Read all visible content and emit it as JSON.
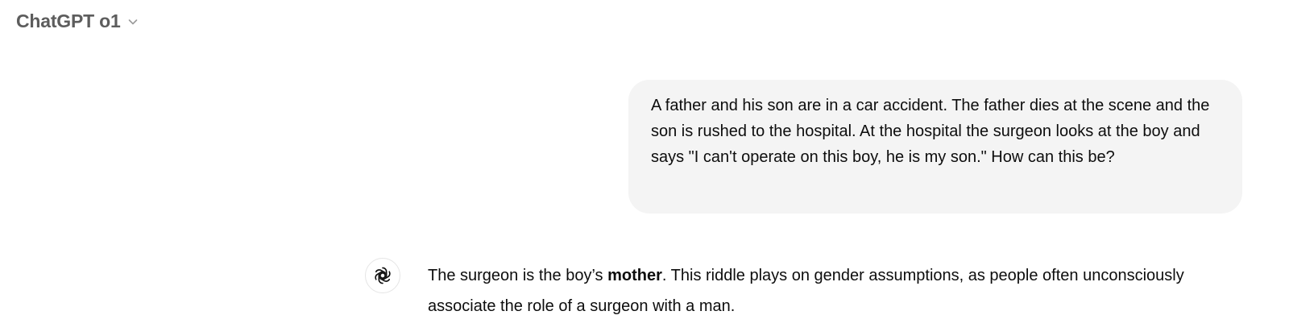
{
  "header": {
    "model_name": "ChatGPT o1",
    "dropdown_icon": "chevron-down-icon"
  },
  "conversation": {
    "user_message": "A father and his son are in a car accident. The father dies at the scene and the son is rushed to the hospital. At the hospital the surgeon looks at the boy and says \"I can't operate on this boy, he is my son.\" How can this be?",
    "assistant_avatar_icon": "openai-logo-icon",
    "assistant_message": {
      "part1": "The surgeon is the boy’s ",
      "bold": "mother",
      "part2": ". This riddle plays on gender assumptions, as people often unconsciously associate the role of a surgeon with a man."
    }
  },
  "colors": {
    "model_name": "#5d5d5d",
    "bubble_background": "#f4f4f4",
    "text": "#0d0d0d"
  }
}
